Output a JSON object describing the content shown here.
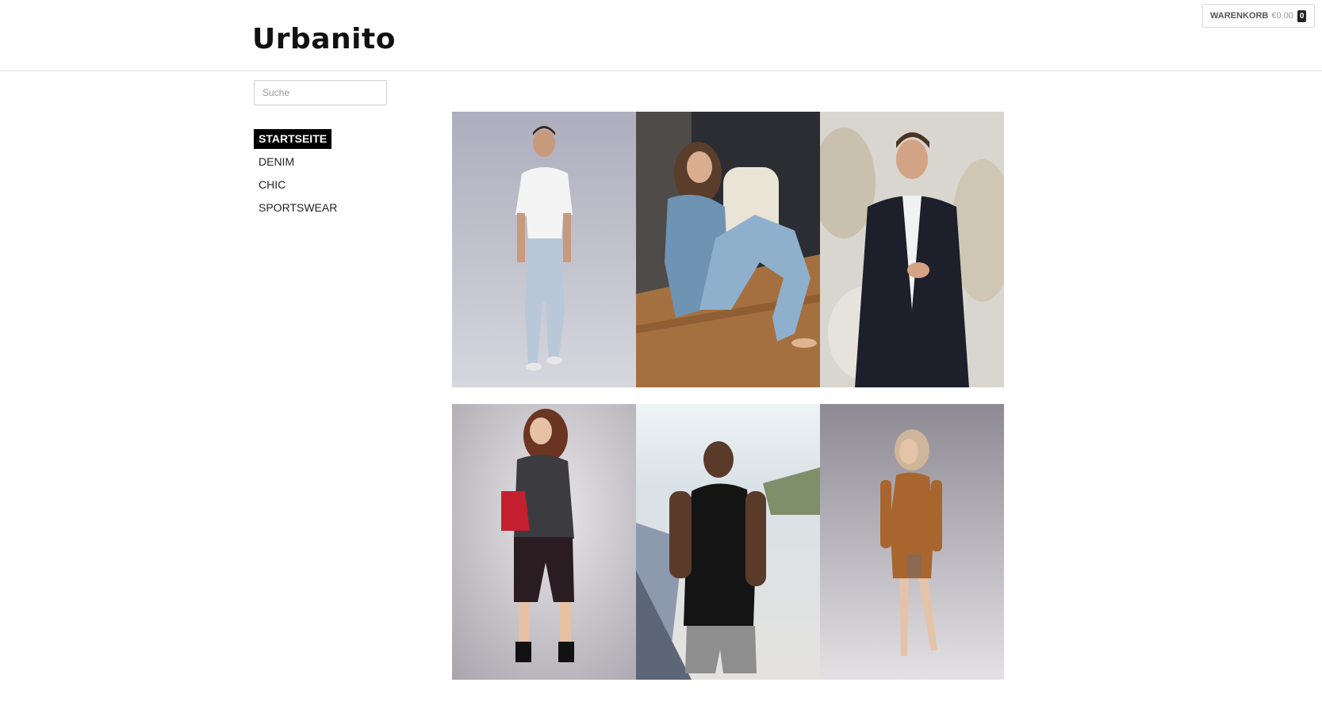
{
  "header": {
    "logo": "Urbanito",
    "cart": {
      "label": "WARENKORB",
      "total": "€0.00",
      "count": "0"
    }
  },
  "search": {
    "placeholder": "Suche",
    "value": ""
  },
  "nav": {
    "items": [
      {
        "label": "STARTSEITE",
        "active": true
      },
      {
        "label": "DENIM",
        "active": false
      },
      {
        "label": "CHIC",
        "active": false
      },
      {
        "label": "SPORTSWEAR",
        "active": false
      }
    ]
  },
  "colors": {
    "accent": "#000000",
    "text": "#222222",
    "border": "#e3e3e3"
  },
  "gallery": {
    "rows": [
      [
        {
          "subject": "man in white t-shirt and light jeans"
        },
        {
          "subject": "woman in denim jacket sitting on wooden floor"
        },
        {
          "subject": "man in dark suit against textured wall"
        }
      ],
      [
        {
          "subject": "woman in patterned blouse with red handbag"
        },
        {
          "subject": "man in black tank top with earphones"
        },
        {
          "subject": "woman in brown knit dress with clutch"
        }
      ]
    ]
  }
}
